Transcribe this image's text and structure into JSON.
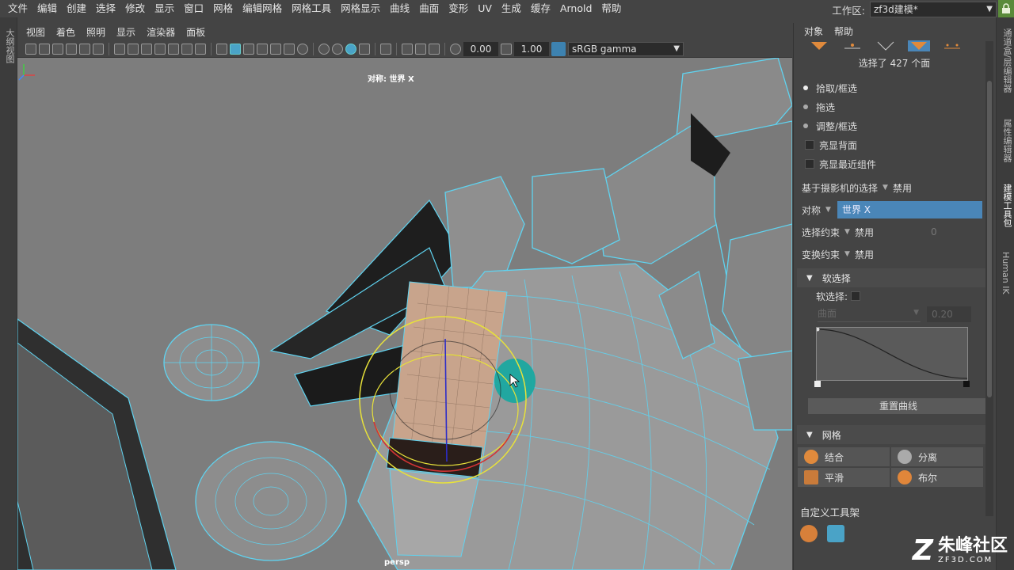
{
  "menu": [
    "文件",
    "编辑",
    "创建",
    "选择",
    "修改",
    "显示",
    "窗口",
    "网格",
    "编辑网格",
    "网格工具",
    "网格显示",
    "曲线",
    "曲面",
    "变形",
    "UV",
    "生成",
    "缓存",
    "Arnold",
    "帮助"
  ],
  "workspace": {
    "label": "工作区:",
    "value": "zf3d建模*"
  },
  "left_strip_label": "大纲视图",
  "panel_menu": [
    "视图",
    "着色",
    "照明",
    "显示",
    "渲染器",
    "面板"
  ],
  "viewport_toolbar": {
    "near_value": "0.00",
    "exposure_value": "1.00",
    "color_space": "sRGB gamma"
  },
  "viewport": {
    "symmetry_label": "对称: 世界 X",
    "camera_label": "persp"
  },
  "right_strip": [
    "通道盒/层编辑器",
    "属性编辑器",
    "建模工具包",
    "Human IK"
  ],
  "tool_panel": {
    "menu": [
      "对象",
      "帮助"
    ],
    "selection_count": "选择了 427 个面",
    "pick_modes": [
      "拾取/框选",
      "拖选",
      "调整/框选"
    ],
    "checkboxes": [
      "亮显背面",
      "亮显最近组件"
    ],
    "camera_based": {
      "label": "基于摄影机的选择",
      "value": "禁用"
    },
    "symmetry": {
      "label": "对称",
      "value": "世界 X"
    },
    "select_constraint": {
      "label": "选择约束",
      "value": "禁用",
      "num": "0"
    },
    "transform_constraint": {
      "label": "变换约束",
      "value": "禁用"
    },
    "soft_select_section": "软选择",
    "soft_select_label": "软选择:",
    "falloff_mode": "曲面",
    "falloff_radius": "0.20",
    "reset_curve": "重置曲线",
    "mesh_section": "网格",
    "mesh_buttons": [
      "结合",
      "分离",
      "平滑",
      "布尔"
    ],
    "custom_shelf": "自定义工具架"
  },
  "watermark": {
    "logo": "Z",
    "name": "朱峰社区",
    "url": "ZF3D.COM"
  },
  "colors": {
    "wire": "#5fd3f0",
    "soft_select": "#1aa8a0",
    "selected_face": "#c8a48c",
    "accent": "#4a86b8"
  }
}
